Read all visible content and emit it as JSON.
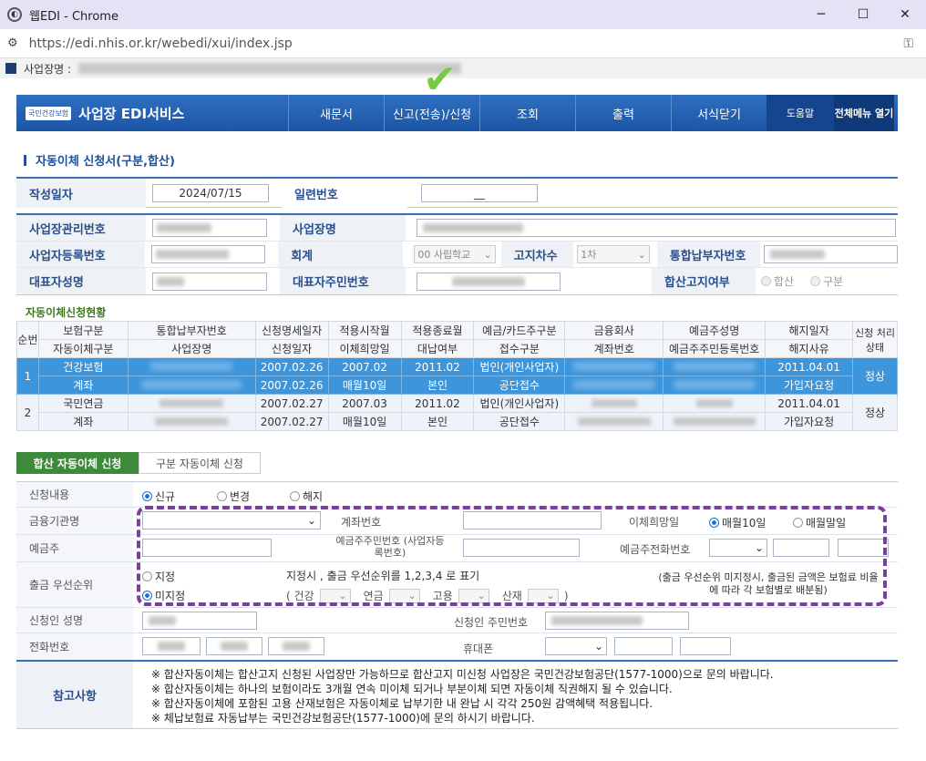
{
  "window": {
    "title": "웹EDI - Chrome",
    "url": "https://edi.nhis.or.kr/webedi/xui/index.jsp",
    "minimize": "─",
    "maximize": "☐",
    "close": "✕"
  },
  "infobar": {
    "label": "사업장명 :"
  },
  "nav": {
    "logo_text": "국민건강보험",
    "title": "사업장 EDI서비스",
    "menu": [
      "새문서",
      "신고(전송)/신청",
      "조회",
      "출력",
      "서식닫기"
    ],
    "help": "도움말",
    "all_menu": "전체메뉴 열기"
  },
  "page": {
    "title": "자동이체 신청서(구분,합산)"
  },
  "header": {
    "date_label": "작성일자",
    "date_value": "2024/07/15",
    "serial_label": "일련번호",
    "serial_value": "__"
  },
  "biz": {
    "mgmt_no_label": "사업장관리번호",
    "name_label": "사업장명",
    "reg_no_label": "사업자등록번호",
    "account_label": "회계",
    "account_value": "00 사립학교",
    "notice_label": "고지차수",
    "notice_value": "1차",
    "payer_no_label": "통합납부자번호",
    "rep_name_label": "대표자성명",
    "rep_id_label": "대표자주민번호",
    "combined_label": "합산고지여부",
    "combined_opt1": "합산",
    "combined_opt2": "구분"
  },
  "status": {
    "title": "자동이체신청현황",
    "header1": [
      "보험구분",
      "통합납부자번호",
      "신청명세일자",
      "적용시작월",
      "적용종료월",
      "예금/카드주구분",
      "금융회사",
      "예금주성명",
      "해지일자"
    ],
    "header2": [
      "자동이체구분",
      "사업장명",
      "신청일자",
      "이체희망일",
      "대납여부",
      "접수구분",
      "계좌번호",
      "예금주주민등록번호",
      "해지사유"
    ],
    "col_no": "순번",
    "col_state": "신청 처리상태",
    "rows": [
      {
        "no": "1",
        "r1": [
          "건강보험",
          "",
          "2007.02.26",
          "2007.02",
          "2011.02",
          "법인(개인사업자)",
          "",
          "",
          "2011.04.01"
        ],
        "r2": [
          "계좌",
          "",
          "2007.02.26",
          "매월10일",
          "본인",
          "공단접수",
          "",
          "",
          "가입자요청"
        ],
        "state": "정상"
      },
      {
        "no": "2",
        "r1": [
          "국민연금",
          "",
          "2007.02.27",
          "2007.03",
          "2011.02",
          "법인(개인사업자)",
          "",
          "",
          "2011.04.01"
        ],
        "r2": [
          "계좌",
          "",
          "2007.02.27",
          "매월10일",
          "본인",
          "공단접수",
          "",
          "",
          "가입자요청"
        ],
        "state": "정상"
      }
    ]
  },
  "tabs": {
    "combined": "합산 자동이체 신청",
    "separate": "구분 자동이체 신청"
  },
  "form": {
    "content_label": "신청내용",
    "content_opts": [
      "신규",
      "변경",
      "해지"
    ],
    "bank_label": "금융기관명",
    "account_no_label": "계좌번호",
    "transfer_day_label": "이체희망일",
    "transfer_opts": [
      "매월10일",
      "매월말일"
    ],
    "holder_label": "예금주",
    "holder_id_label": "예금주주민번호 (사업자등록번호)",
    "holder_phone_label": "예금주전화번호",
    "priority_label": "출금 우선순위",
    "priority_opts": [
      "지정",
      "미지정"
    ],
    "priority_hint": "지정시 , 출금 우선순위를 1,2,3,4 로 표기",
    "priority_items": [
      "( 건강",
      "연금",
      "고용",
      "산재",
      ")"
    ],
    "priority_note": "(출금 우선순위 미지정시, 출금된 금액은 보험료 비율에 따라 각 보험별로 배분됨)",
    "applicant_label": "신청인 성명",
    "applicant_id_label": "신청인 주민번호",
    "phone_label": "전화번호",
    "mobile_label": "휴대폰"
  },
  "notes": {
    "label": "참고사항",
    "lines": [
      "※  합산자동이체는 합산고지 신청된 사업장만 가능하므로 합산고지 미신청 사업장은 국민건강보험공단(1577-1000)으로 문의 바랍니다.",
      "※  합산자동이체는 하나의 보험이라도 3개월 연속 미이체 되거나 부분이체 되면 자동이체 직권해지 될 수 있습니다.",
      "※  합산자동이체에 포함된 고용 산재보험은 자동이체로 납부기한 내 완납 시 각각 250원 감액혜택 적용됩니다.",
      "※  체납보험료 자동납부는 국민건강보험공단(1577-1000)에 문의 하시기 바랍니다."
    ]
  }
}
